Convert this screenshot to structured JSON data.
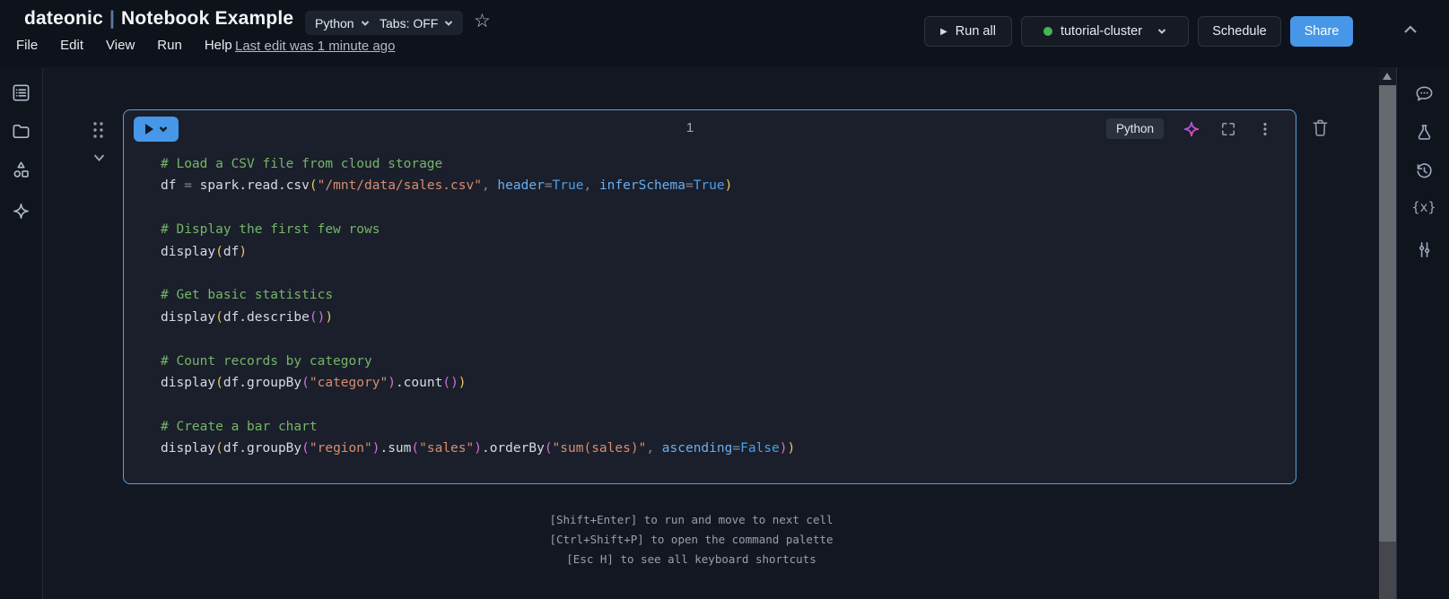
{
  "app": {
    "accent_blue": "#4697e8",
    "cell_border_blue": "#5a9ed6",
    "cluster_status_green": "#43b556"
  },
  "header": {
    "title": {
      "name": "dateonic",
      "separator": "|",
      "subtitle": "Notebook Example"
    },
    "language_selector": {
      "label": "Python"
    },
    "tabs_selector": {
      "label": "Tabs: OFF"
    },
    "favorite_icon": "star-icon",
    "menus": [
      "File",
      "Edit",
      "View",
      "Run",
      "Help"
    ],
    "last_edit_link": "Last edit was 1 minute ago",
    "run_all_button": "Run all",
    "cluster_selector": "tutorial-cluster",
    "schedule_button": "Schedule",
    "share_button": "Share"
  },
  "left_rail": {
    "icons": [
      "notebook-panel-icon",
      "folder-icon",
      "workflows-icon",
      "assistant-sparkle-icon"
    ]
  },
  "right_rail": {
    "icons": [
      "comments-icon",
      "experiments-icon",
      "version-history-icon",
      "variables-icon",
      "settings-sliders-icon"
    ],
    "variables_glyph": "{x}"
  },
  "cell": {
    "number": "1",
    "language_label": "Python",
    "code": {
      "colors": {
        "cm": "#76b567",
        "pl": "#d6dbe3",
        "st": "#d98d6e",
        "pr": "#68aef2",
        "kw": "#4d9fe8",
        "op": "#7d8694",
        "b1": "#edc95c",
        "b2": "#d470d4"
      },
      "lines": [
        [
          {
            "s": "# Load a CSV file from cloud storage",
            "c": "cm"
          }
        ],
        [
          {
            "s": "df ",
            "c": "pl"
          },
          {
            "s": "=",
            "c": "op"
          },
          {
            "s": " spark.read.csv",
            "c": "pl"
          },
          {
            "s": "(",
            "c": "b1"
          },
          {
            "s": "\"/mnt/data/sales.csv\"",
            "c": "st"
          },
          {
            "s": ", ",
            "c": "op"
          },
          {
            "s": "header",
            "c": "pr"
          },
          {
            "s": "=",
            "c": "op"
          },
          {
            "s": "True",
            "c": "kw"
          },
          {
            "s": ", ",
            "c": "op"
          },
          {
            "s": "inferSchema",
            "c": "pr"
          },
          {
            "s": "=",
            "c": "op"
          },
          {
            "s": "True",
            "c": "kw"
          },
          {
            "s": ")",
            "c": "b1"
          }
        ],
        [],
        [
          {
            "s": "# Display the first few rows",
            "c": "cm"
          }
        ],
        [
          {
            "s": "display",
            "c": "pl"
          },
          {
            "s": "(",
            "c": "b1"
          },
          {
            "s": "df",
            "c": "pl"
          },
          {
            "s": ")",
            "c": "b1"
          }
        ],
        [],
        [
          {
            "s": "# Get basic statistics",
            "c": "cm"
          }
        ],
        [
          {
            "s": "display",
            "c": "pl"
          },
          {
            "s": "(",
            "c": "b1"
          },
          {
            "s": "df.describe",
            "c": "pl"
          },
          {
            "s": "(",
            "c": "b2"
          },
          {
            "s": ")",
            "c": "b2"
          },
          {
            "s": ")",
            "c": "b1"
          }
        ],
        [],
        [
          {
            "s": "# Count records by category",
            "c": "cm"
          }
        ],
        [
          {
            "s": "display",
            "c": "pl"
          },
          {
            "s": "(",
            "c": "b1"
          },
          {
            "s": "df.groupBy",
            "c": "pl"
          },
          {
            "s": "(",
            "c": "b2"
          },
          {
            "s": "\"category\"",
            "c": "st"
          },
          {
            "s": ")",
            "c": "b2"
          },
          {
            "s": ".count",
            "c": "pl"
          },
          {
            "s": "(",
            "c": "b2"
          },
          {
            "s": ")",
            "c": "b2"
          },
          {
            "s": ")",
            "c": "b1"
          }
        ],
        [],
        [
          {
            "s": "# Create a bar chart",
            "c": "cm"
          }
        ],
        [
          {
            "s": "display",
            "c": "pl"
          },
          {
            "s": "(",
            "c": "b1"
          },
          {
            "s": "df.groupBy",
            "c": "pl"
          },
          {
            "s": "(",
            "c": "b2"
          },
          {
            "s": "\"region\"",
            "c": "st"
          },
          {
            "s": ")",
            "c": "b2"
          },
          {
            "s": ".sum",
            "c": "pl"
          },
          {
            "s": "(",
            "c": "b2"
          },
          {
            "s": "\"sales\"",
            "c": "st"
          },
          {
            "s": ")",
            "c": "b2"
          },
          {
            "s": ".orderBy",
            "c": "pl"
          },
          {
            "s": "(",
            "c": "b2"
          },
          {
            "s": "\"sum(sales)\"",
            "c": "st"
          },
          {
            "s": ", ",
            "c": "op"
          },
          {
            "s": "ascending",
            "c": "pr"
          },
          {
            "s": "=",
            "c": "op"
          },
          {
            "s": "False",
            "c": "kw"
          },
          {
            "s": ")",
            "c": "b2"
          },
          {
            "s": ")",
            "c": "b1"
          }
        ]
      ]
    }
  },
  "hints": [
    "[Shift+Enter] to run and move to next cell",
    "[Ctrl+Shift+P] to open the command palette",
    "[Esc H] to see all keyboard shortcuts"
  ]
}
